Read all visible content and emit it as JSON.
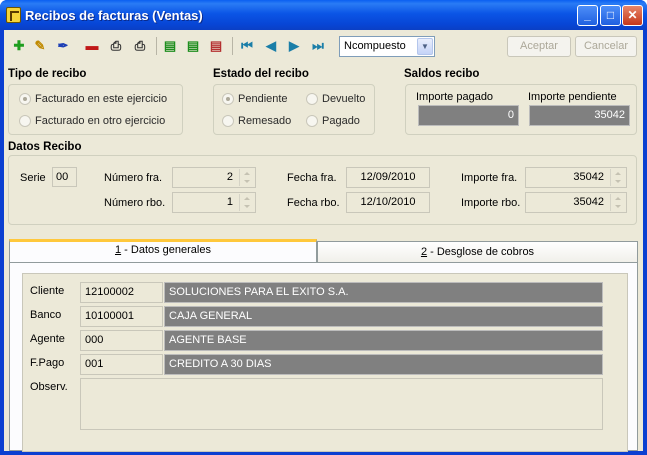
{
  "window": {
    "title": "Recibos de facturas (Ventas)"
  },
  "title_buttons": {
    "minimize": "_",
    "maximize": "□",
    "close": "✕"
  },
  "toolbar": {
    "buttons": [
      {
        "name": "add-record-button",
        "icon": "plus-icon",
        "glyph": "✚",
        "color": "#1e9e1e"
      },
      {
        "name": "edit-record-button",
        "icon": "pencil-icon",
        "glyph": "✎",
        "color": "#c08a00"
      },
      {
        "name": "edit-alt-button",
        "icon": "pen-icon",
        "glyph": "✒",
        "color": "#1d3fb5"
      },
      {
        "name": "delete-record-button",
        "icon": "minus-icon",
        "glyph": "▬",
        "color": "#c01818"
      },
      {
        "name": "print-button",
        "icon": "printer-icon",
        "glyph": "⎙",
        "color": "#333333"
      },
      {
        "name": "print-preview-button",
        "icon": "printer-preview-icon",
        "glyph": "⎙",
        "color": "#333333"
      },
      {
        "name": "list-button",
        "icon": "list-icon",
        "glyph": "▤",
        "color": "#1e8e1e"
      },
      {
        "name": "list-add-button",
        "icon": "list-add-icon",
        "glyph": "▤",
        "color": "#1e8e1e"
      },
      {
        "name": "list-remove-button",
        "icon": "list-remove-icon",
        "glyph": "▤",
        "color": "#b43030"
      },
      {
        "name": "first-record-button",
        "icon": "first-icon",
        "glyph": "⏮",
        "color": "#1a7ea8"
      },
      {
        "name": "prev-record-button",
        "icon": "prev-icon",
        "glyph": "◀",
        "color": "#1a7ea8"
      },
      {
        "name": "next-record-button",
        "icon": "next-icon",
        "glyph": "▶",
        "color": "#1a7ea8"
      },
      {
        "name": "last-record-button",
        "icon": "last-icon",
        "glyph": "⏭",
        "color": "#1a7ea8"
      }
    ],
    "mode_select": "Ncompuesto",
    "accept_label": "Aceptar",
    "cancel_label": "Cancelar"
  },
  "tipo_recibo": {
    "title": "Tipo de recibo",
    "options": [
      "Facturado en este ejercicio",
      "Facturado en otro ejercicio"
    ],
    "selected": 0
  },
  "estado_recibo": {
    "title": "Estado del recibo",
    "options": [
      "Pendiente",
      "Devuelto",
      "Remesado",
      "Pagado"
    ],
    "selected": 0
  },
  "saldos": {
    "title": "Saldos recibo",
    "importe_pagado_label": "Importe pagado",
    "importe_pagado": "0",
    "importe_pendiente_label": "Importe pendiente",
    "importe_pendiente": "35042"
  },
  "datos_recibo": {
    "title": "Datos Recibo",
    "serie_label": "Serie",
    "serie": "00",
    "numero_fra_label": "Número fra.",
    "numero_fra": "2",
    "numero_rbo_label": "Número rbo.",
    "numero_rbo": "1",
    "fecha_fra_label": "Fecha fra.",
    "fecha_fra": "12/09/2010",
    "fecha_rbo_label": "Fecha rbo.",
    "fecha_rbo": "12/10/2010",
    "importe_fra_label": "Importe fra.",
    "importe_fra": "35042",
    "importe_rbo_label": "Importe rbo.",
    "importe_rbo": "35042"
  },
  "tabs": [
    {
      "num": "1",
      "label": " - Datos generales"
    },
    {
      "num": "2",
      "label": " - Desglose de cobros"
    }
  ],
  "datos_generales": {
    "cliente_label": "Cliente",
    "cliente_code": "12100002",
    "cliente_name": "SOLUCIONES PARA EL EXITO S.A.",
    "banco_label": "Banco",
    "banco_code": "10100001",
    "banco_name": "CAJA GENERAL",
    "agente_label": "Agente",
    "agente_code": "000",
    "agente_name": "AGENTE BASE",
    "fpago_label": "F.Pago",
    "fpago_code": "001",
    "fpago_name": "CREDITO A 30 DIAS",
    "observ_label": "Observ.",
    "observ": ""
  }
}
